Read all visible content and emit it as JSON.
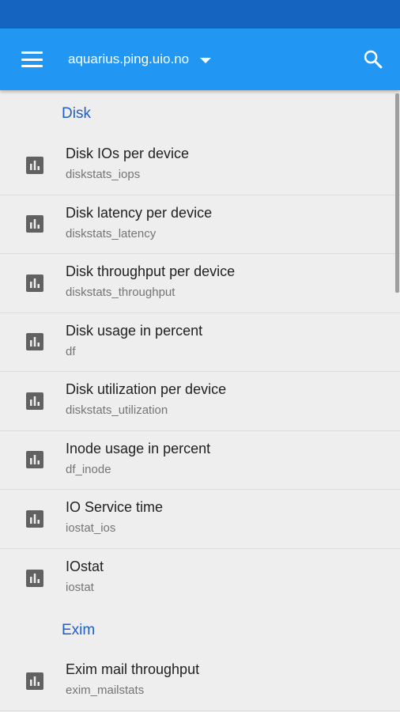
{
  "app_bar": {
    "server_name": "aquarius.ping.uio.no",
    "menu_icon": "hamburger-menu-icon",
    "dropdown_icon": "arrow-drop-down-icon",
    "search_icon": "search-icon"
  },
  "colors": {
    "status_bar": "#1565c0",
    "app_bar": "#2196f3",
    "section_header": "#1e5fc8",
    "background": "#eeeeee",
    "icon": "#616161"
  },
  "sections": [
    {
      "title": "Disk",
      "items": [
        {
          "title": "Disk IOs per device",
          "subtitle": "diskstats_iops",
          "icon": "bar-chart-icon"
        },
        {
          "title": "Disk latency per device",
          "subtitle": "diskstats_latency",
          "icon": "bar-chart-icon"
        },
        {
          "title": "Disk throughput per device",
          "subtitle": "diskstats_throughput",
          "icon": "bar-chart-icon"
        },
        {
          "title": "Disk usage in percent",
          "subtitle": "df",
          "icon": "bar-chart-icon"
        },
        {
          "title": "Disk utilization per device",
          "subtitle": "diskstats_utilization",
          "icon": "bar-chart-icon"
        },
        {
          "title": "Inode usage in percent",
          "subtitle": "df_inode",
          "icon": "bar-chart-icon"
        },
        {
          "title": "IO Service time",
          "subtitle": "iostat_ios",
          "icon": "bar-chart-icon"
        },
        {
          "title": "IOstat",
          "subtitle": "iostat",
          "icon": "bar-chart-icon"
        }
      ]
    },
    {
      "title": "Exim",
      "items": [
        {
          "title": "Exim mail throughput",
          "subtitle": "exim_mailstats",
          "icon": "bar-chart-icon"
        }
      ]
    }
  ]
}
